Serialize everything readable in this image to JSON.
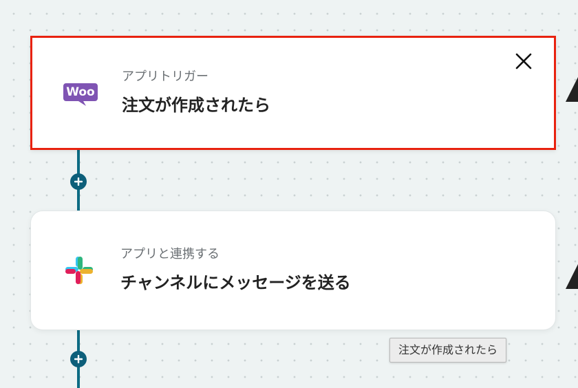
{
  "trigger_card": {
    "app_icon": "woocommerce-icon",
    "logo_text": "Woo",
    "subtitle": "アプリトリガー",
    "title": "注文が作成されたら",
    "border_color": "#e8220f"
  },
  "action_card": {
    "app_icon": "slack-icon",
    "subtitle": "アプリと連携する",
    "title": "チャンネルにメッセージを送る"
  },
  "tooltip": {
    "text": "注文が作成されたら"
  },
  "colors": {
    "connector": "#0d6b83",
    "woo_purple": "#7f54b3"
  }
}
